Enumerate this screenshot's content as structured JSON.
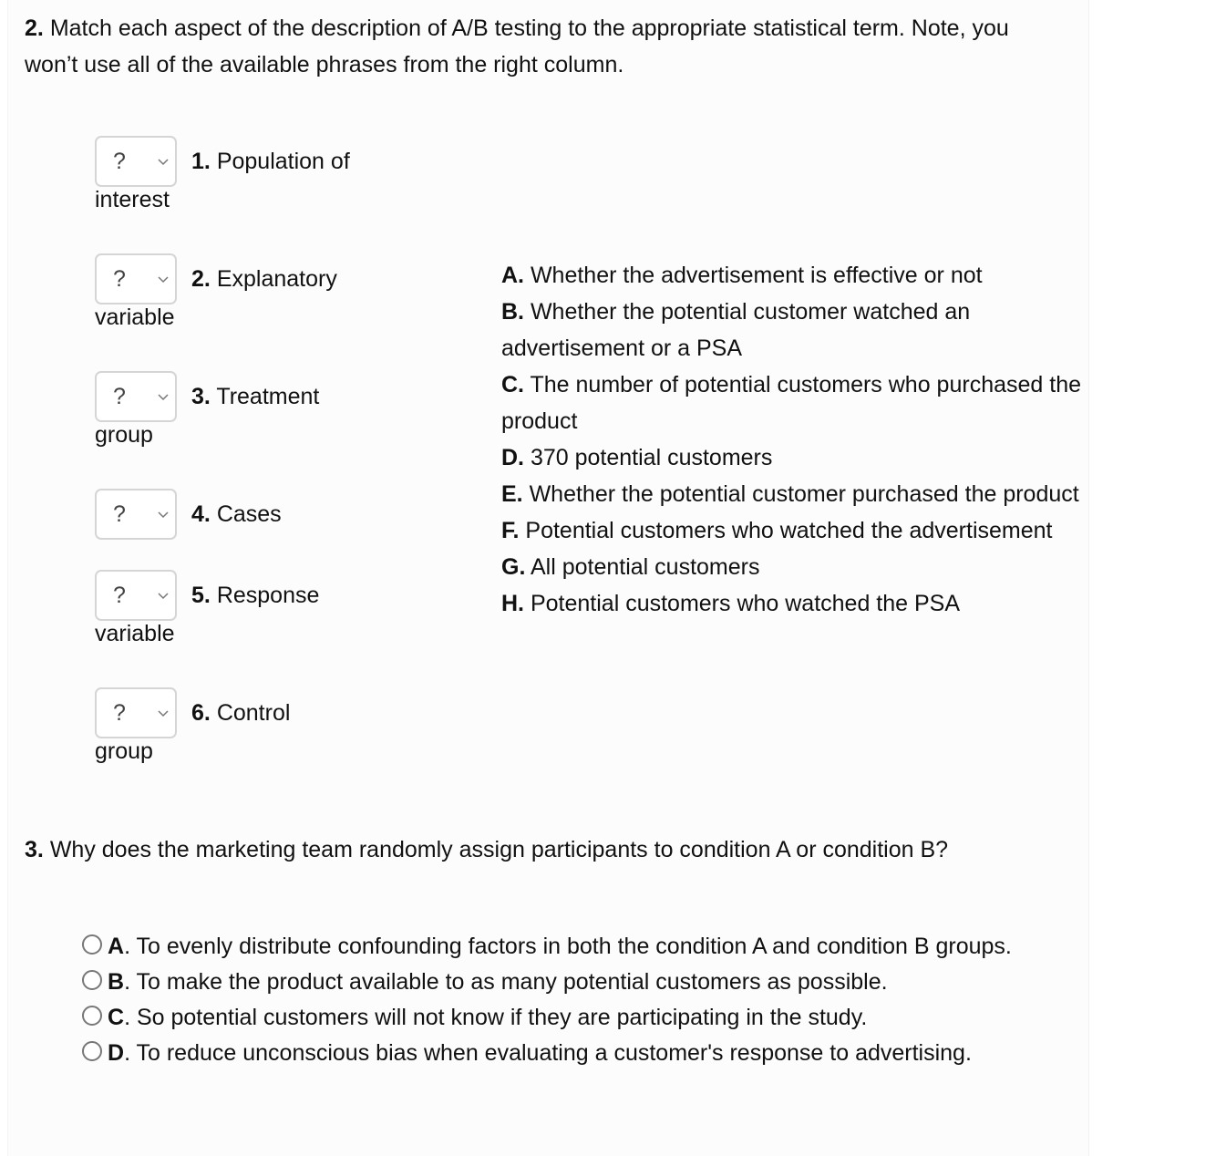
{
  "question2": {
    "number": "2.",
    "text": "Match each aspect of the description of A/B testing to the appropriate statistical term. Note, you won’t use all of the available phrases from the right column.",
    "items": [
      {
        "selected": "?",
        "number": "1.",
        "label_line1": "Population of",
        "label_line2": "interest"
      },
      {
        "selected": "?",
        "number": "2.",
        "label_line1": "Explanatory",
        "label_line2": "variable"
      },
      {
        "selected": "?",
        "number": "3.",
        "label_line1": "Treatment",
        "label_line2": "group"
      },
      {
        "selected": "?",
        "number": "4.",
        "label_line1": "Cases",
        "label_line2": ""
      },
      {
        "selected": "?",
        "number": "5.",
        "label_line1": "Response",
        "label_line2": "variable"
      },
      {
        "selected": "?",
        "number": "6.",
        "label_line1": "Control",
        "label_line2": "group"
      }
    ],
    "options": [
      {
        "letter": "A.",
        "text": "Whether the advertisement is effective or not"
      },
      {
        "letter": "B.",
        "text": "Whether the potential customer watched an advertisement or a PSA"
      },
      {
        "letter": "C.",
        "text": "The number of potential customers who purchased the product"
      },
      {
        "letter": "D.",
        "text": "370 potential customers"
      },
      {
        "letter": "E.",
        "text": "Whether the potential customer purchased the product"
      },
      {
        "letter": "F.",
        "text": "Potential customers who watched the advertisement"
      },
      {
        "letter": "G.",
        "text": "All potential customers"
      },
      {
        "letter": "H.",
        "text": "Potential customers who watched the PSA"
      }
    ]
  },
  "question3": {
    "number": "3.",
    "text": "Why does the marketing team randomly assign participants to condition A or condition B?",
    "choices": [
      {
        "letter": "A",
        "text": ". To evenly distribute confounding factors in both the condition A and condition B groups."
      },
      {
        "letter": "B",
        "text": ". To make the product available to as many potential customers as possible."
      },
      {
        "letter": "C",
        "text": ". So potential customers will not know if they are participating in the study."
      },
      {
        "letter": "D",
        "text": ". To reduce unconscious bias when evaluating a customer's response to advertising."
      }
    ]
  }
}
